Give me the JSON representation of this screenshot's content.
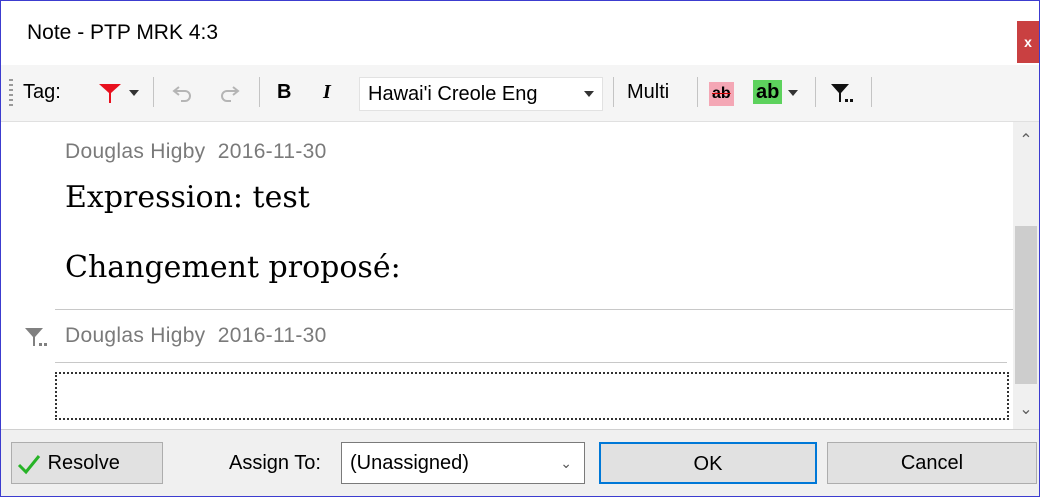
{
  "window": {
    "title": "Note - PTP MRK 4:3",
    "close_label": "x"
  },
  "toolbar": {
    "tag_label": "Tag:",
    "bold_label": "B",
    "italic_label": "I",
    "language_value": "Hawai'i Creole Eng",
    "multi_label": "Multi",
    "strike_label": "ab",
    "highlight_label": "ab",
    "icons": [
      "flag-icon",
      "undo-icon",
      "redo-icon",
      "filter-icon"
    ],
    "colors": {
      "flag": "#e8101e",
      "strike_bg": "#f4a7b5",
      "highlight_bg": "#5dd25d"
    }
  },
  "notes": [
    {
      "author": "Douglas Higby",
      "date": "2016-11-30",
      "lines": [
        "Expression: test",
        "Changement proposé:"
      ]
    },
    {
      "author": "Douglas Higby",
      "date": "2016-11-30",
      "lines": []
    }
  ],
  "reply": {
    "value": ""
  },
  "bottom": {
    "resolve_label": "Resolve",
    "assign_label": "Assign To:",
    "assign_value": "(Unassigned)",
    "ok_label": "OK",
    "cancel_label": "Cancel"
  }
}
